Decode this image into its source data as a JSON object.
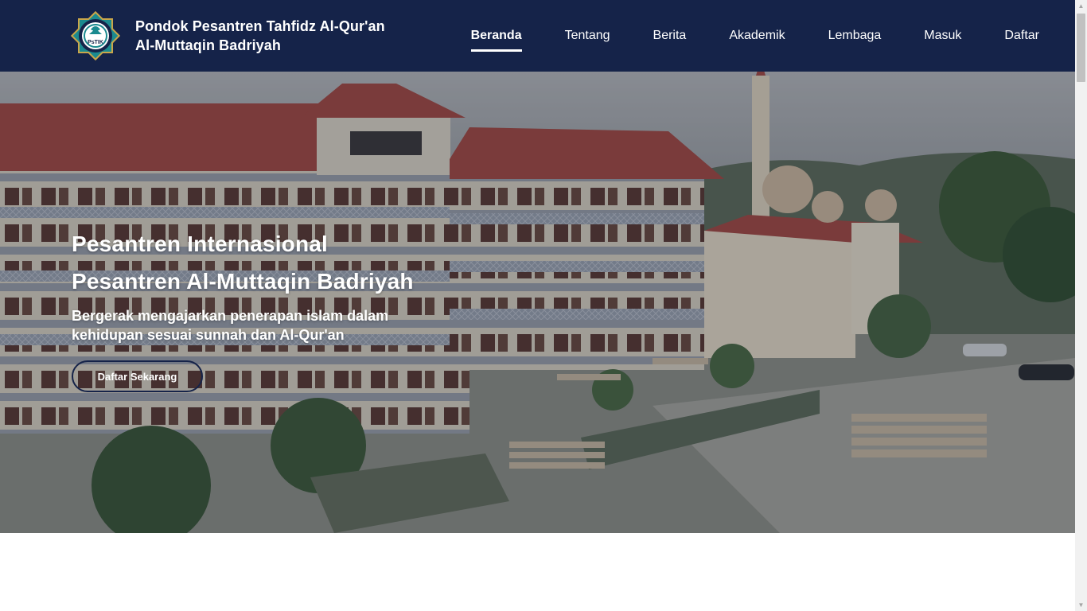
{
  "brand": {
    "name_line1": "Pondok Pesantren Tahfidz Al-Qur'an",
    "name_line2": "Al-Muttaqin Badriyah",
    "logo_text": "PsTIK",
    "logo_icon": "school-emblem-icon"
  },
  "nav": {
    "items": [
      {
        "label": "Beranda",
        "active": true
      },
      {
        "label": "Tentang",
        "active": false
      },
      {
        "label": "Berita",
        "active": false
      },
      {
        "label": "Akademik",
        "active": false
      },
      {
        "label": "Lembaga",
        "active": false
      },
      {
        "label": "Masuk",
        "active": false
      },
      {
        "label": "Daftar",
        "active": false
      }
    ]
  },
  "hero": {
    "title_line1": "Pesantren Internasional",
    "title_line2": "Pesantren Al-Muttaqin Badriyah",
    "subtitle": "Bergerak mengajarkan penerapan islam dalam kehidupan sesuai sunnah dan Al-Qur'an",
    "cta_label": "Daftar Sekarang",
    "image_alt": "aerial-campus-photo"
  },
  "colors": {
    "navbar_bg": "#152349",
    "text_light": "#ffffff",
    "cta_border": "#152349",
    "roof_red": "#a44a44",
    "logo_teal": "#1b8a8f",
    "logo_gold": "#c9a64a"
  }
}
